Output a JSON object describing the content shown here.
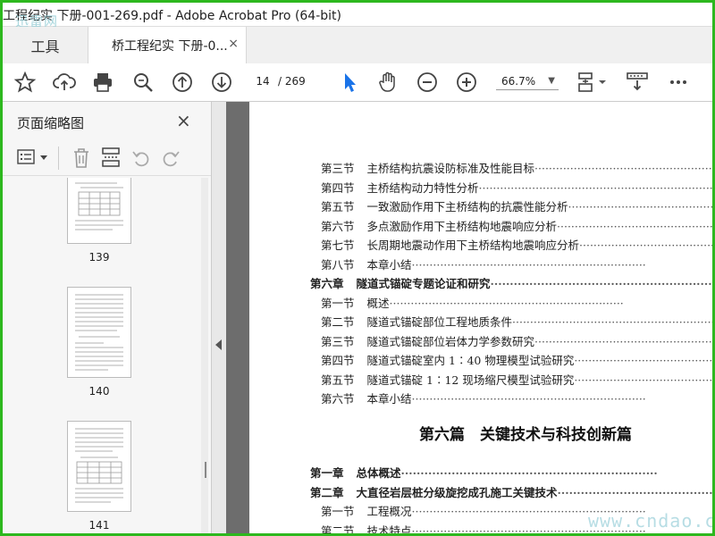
{
  "window": {
    "title": "工程纪实 下册-001-269.pdf - Adobe Acrobat Pro (64-bit)",
    "watermark_top_left": "迅雷网"
  },
  "tabs": {
    "tools_label": "工具",
    "doc_label": "桥工程纪实 下册-0...",
    "close_glyph": "×"
  },
  "toolbar": {
    "current_page": "14",
    "total_pages": "/ 269",
    "zoom": "66.7%",
    "icons": [
      "star-icon",
      "cloud-upload-icon",
      "print-icon",
      "zoom-search-icon",
      "page-up-icon",
      "page-down-icon",
      "select-cursor-icon",
      "hand-icon",
      "zoom-out-icon",
      "zoom-in-icon",
      "fit-page-icon",
      "scroll-mode-icon",
      "more-icon"
    ]
  },
  "sidebar": {
    "title": "页面缩略图",
    "close_glyph": "×",
    "thumbnails": [
      {
        "label": "139"
      },
      {
        "label": "140"
      },
      {
        "label": "141"
      }
    ]
  },
  "document": {
    "toc": [
      {
        "num": "第三节",
        "text": "主桥结构抗震设防标准及性能目标",
        "bold": false
      },
      {
        "num": "第四节",
        "text": "主桥结构动力特性分析",
        "bold": false
      },
      {
        "num": "第五节",
        "text": "一致激励作用下主桥结构的抗震性能分析",
        "bold": false
      },
      {
        "num": "第六节",
        "text": "多点激励作用下主桥结构地震响应分析",
        "bold": false
      },
      {
        "num": "第七节",
        "text": "长周期地震动作用下主桥结构地震响应分析",
        "bold": false
      },
      {
        "num": "第八节",
        "text": "本章小结",
        "bold": false
      },
      {
        "num": "第六章",
        "text": "隧道式锚碇专题论证和研究",
        "bold": true
      },
      {
        "num": "第一节",
        "text": "概述",
        "bold": false
      },
      {
        "num": "第二节",
        "text": "隧道式锚碇部位工程地质条件",
        "bold": false
      },
      {
        "num": "第三节",
        "text": "隧道式锚碇部位岩体力学参数研究",
        "bold": false
      },
      {
        "num": "第四节",
        "text": "隧道式锚碇室内 1∶40 物理模型试验研究",
        "bold": false
      },
      {
        "num": "第五节",
        "text": "隧道式锚碇 1∶12 现场缩尺模型试验研究",
        "bold": false
      },
      {
        "num": "第六节",
        "text": "本章小结",
        "bold": false
      }
    ],
    "part_heading": "第六篇　关键技术与科技创新篇",
    "toc2": [
      {
        "num": "第一章",
        "text": "总体概述",
        "bold": true
      },
      {
        "num": "第二章",
        "text": "大直径岩层桩分级旋挖成孔施工关键技术",
        "bold": true
      },
      {
        "num": "第一节",
        "text": "工程概况",
        "bold": false
      },
      {
        "num": "第二节",
        "text": "技术特点",
        "bold": false
      }
    ]
  },
  "watermark_bottom_right": "www.cndao.com",
  "colors": {
    "frame_border": "#2db81e",
    "annotation_red": "#e02020",
    "select_blue": "#1a73e8"
  }
}
